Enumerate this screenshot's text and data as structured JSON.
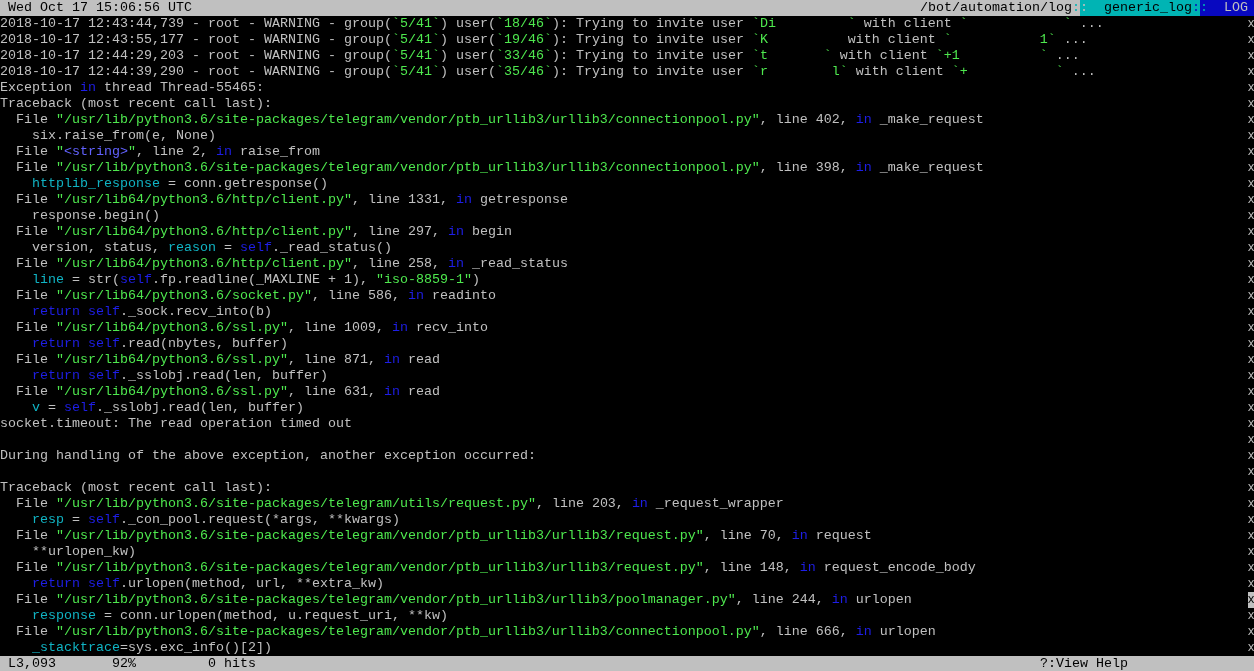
{
  "top_bar": {
    "clock": "Wed Oct 17 15:06:56 UTC",
    "crumbs": [
      {
        "kind": "path",
        "text": "/bot/automation/log",
        "after": ":"
      },
      {
        "kind": "format",
        "before": ":",
        "text": "generic_log",
        "after": ":"
      },
      {
        "kind": "view",
        "before": ":",
        "text": "LOG"
      }
    ]
  },
  "lines": [
    {
      "kind": "entry",
      "segments": [
        {
          "text": "2018-10-17 12:43:44,739 - root - WARNING - group(",
          "kind": "plain"
        },
        {
          "text": "`5/41`",
          "kind": "string"
        },
        {
          "text": ") user(",
          "kind": "plain"
        },
        {
          "text": "`18/46`",
          "kind": "string"
        },
        {
          "text": "): Trying to invite user ",
          "kind": "plain"
        },
        {
          "text": "`Di         `",
          "kind": "string"
        },
        {
          "text": " with client ",
          "kind": "plain"
        },
        {
          "text": "`            `",
          "kind": "string"
        },
        {
          "text": " ...",
          "kind": "plain"
        }
      ]
    },
    {
      "kind": "entry",
      "segments": [
        {
          "text": "2018-10-17 12:43:55,177 - root - WARNING - group(",
          "kind": "plain"
        },
        {
          "text": "`5/41`",
          "kind": "string"
        },
        {
          "text": ") user(",
          "kind": "plain"
        },
        {
          "text": "`19/46`",
          "kind": "string"
        },
        {
          "text": "): Trying to invite user ",
          "kind": "plain"
        },
        {
          "text": "`K         ",
          "kind": "string"
        },
        {
          "text": " with client ",
          "kind": "plain"
        },
        {
          "text": "`           1`",
          "kind": "string"
        },
        {
          "text": " ...",
          "kind": "plain"
        }
      ]
    },
    {
      "kind": "entry",
      "segments": [
        {
          "text": "2018-10-17 12:44:29,203 - root - WARNING - group(",
          "kind": "plain"
        },
        {
          "text": "`5/41`",
          "kind": "string"
        },
        {
          "text": ") user(",
          "kind": "plain"
        },
        {
          "text": "`33/46`",
          "kind": "string"
        },
        {
          "text": "): Trying to invite user ",
          "kind": "plain"
        },
        {
          "text": "`t       `",
          "kind": "string"
        },
        {
          "text": " with client ",
          "kind": "plain"
        },
        {
          "text": "`+1          `",
          "kind": "string"
        },
        {
          "text": " ...",
          "kind": "plain"
        }
      ]
    },
    {
      "kind": "entry",
      "segments": [
        {
          "text": "2018-10-17 12:44:39,290 - root - WARNING - group(",
          "kind": "plain"
        },
        {
          "text": "`5/41`",
          "kind": "string"
        },
        {
          "text": ") user(",
          "kind": "plain"
        },
        {
          "text": "`35/46`",
          "kind": "string"
        },
        {
          "text": "): Trying to invite user ",
          "kind": "plain"
        },
        {
          "text": "`r        l`",
          "kind": "string"
        },
        {
          "text": " with client ",
          "kind": "plain"
        },
        {
          "text": "`+           `",
          "kind": "string"
        },
        {
          "text": " ...",
          "kind": "plain"
        }
      ]
    },
    {
      "kind": "message",
      "segments": [
        {
          "text": "Exception ",
          "kind": "plain"
        },
        {
          "text": "in",
          "kind": "keyword"
        },
        {
          "text": " thread Thread-55465:",
          "kind": "plain"
        }
      ]
    },
    {
      "kind": "message",
      "segments": [
        {
          "text": "Traceback (most recent call last):",
          "kind": "plain"
        }
      ]
    },
    {
      "kind": "frame",
      "segments": [
        {
          "text": "File ",
          "kind": "plain"
        },
        {
          "text": "\"/usr/lib/python3.6/site-packages/telegram/vendor/ptb_urllib3/urllib3/connectionpool.py\"",
          "kind": "string"
        },
        {
          "text": ", line 402, ",
          "kind": "plain"
        },
        {
          "text": "in",
          "kind": "keyword"
        },
        {
          "text": " _make_request",
          "kind": "plain"
        }
      ]
    },
    {
      "kind": "source",
      "segments": [
        {
          "text": "six.raise_from(e, None)",
          "kind": "plain"
        }
      ]
    },
    {
      "kind": "frame",
      "segments": [
        {
          "text": "File ",
          "kind": "plain"
        },
        {
          "text": "\"",
          "kind": "string"
        },
        {
          "text": "<string>",
          "kind": "literal"
        },
        {
          "text": "\"",
          "kind": "string"
        },
        {
          "text": ", line 2, ",
          "kind": "plain"
        },
        {
          "text": "in",
          "kind": "keyword"
        },
        {
          "text": " raise_from",
          "kind": "plain"
        }
      ]
    },
    {
      "kind": "frame",
      "segments": [
        {
          "text": "File ",
          "kind": "plain"
        },
        {
          "text": "\"/usr/lib/python3.6/site-packages/telegram/vendor/ptb_urllib3/urllib3/connectionpool.py\"",
          "kind": "string"
        },
        {
          "text": ", line 398, ",
          "kind": "plain"
        },
        {
          "text": "in",
          "kind": "keyword"
        },
        {
          "text": " _make_request",
          "kind": "plain"
        }
      ]
    },
    {
      "kind": "source",
      "segments": [
        {
          "text": "httplib_response",
          "kind": "name"
        },
        {
          "text": " = conn.getresponse()",
          "kind": "plain"
        }
      ]
    },
    {
      "kind": "frame",
      "segments": [
        {
          "text": "File ",
          "kind": "plain"
        },
        {
          "text": "\"/usr/lib64/python3.6/http/client.py\"",
          "kind": "string"
        },
        {
          "text": ", line 1331, ",
          "kind": "plain"
        },
        {
          "text": "in",
          "kind": "keyword"
        },
        {
          "text": " getresponse",
          "kind": "plain"
        }
      ]
    },
    {
      "kind": "source",
      "segments": [
        {
          "text": "response.begin()",
          "kind": "plain"
        }
      ]
    },
    {
      "kind": "frame",
      "segments": [
        {
          "text": "File ",
          "kind": "plain"
        },
        {
          "text": "\"/usr/lib64/python3.6/http/client.py\"",
          "kind": "string"
        },
        {
          "text": ", line 297, ",
          "kind": "plain"
        },
        {
          "text": "in",
          "kind": "keyword"
        },
        {
          "text": " begin",
          "kind": "plain"
        }
      ]
    },
    {
      "kind": "source",
      "segments": [
        {
          "text": "version, status, ",
          "kind": "plain"
        },
        {
          "text": "reason",
          "kind": "name"
        },
        {
          "text": " = ",
          "kind": "plain"
        },
        {
          "text": "self",
          "kind": "keyword"
        },
        {
          "text": "._read_status()",
          "kind": "plain"
        }
      ]
    },
    {
      "kind": "frame",
      "segments": [
        {
          "text": "File ",
          "kind": "plain"
        },
        {
          "text": "\"/usr/lib64/python3.6/http/client.py\"",
          "kind": "string"
        },
        {
          "text": ", line 258, ",
          "kind": "plain"
        },
        {
          "text": "in",
          "kind": "keyword"
        },
        {
          "text": " _read_status",
          "kind": "plain"
        }
      ]
    },
    {
      "kind": "source",
      "segments": [
        {
          "text": "line",
          "kind": "name"
        },
        {
          "text": " = str(",
          "kind": "plain"
        },
        {
          "text": "self",
          "kind": "keyword"
        },
        {
          "text": ".fp.readline(_MAXLINE + 1), ",
          "kind": "plain"
        },
        {
          "text": "\"iso-8859-1\"",
          "kind": "string"
        },
        {
          "text": ")",
          "kind": "plain"
        }
      ]
    },
    {
      "kind": "frame",
      "segments": [
        {
          "text": "File ",
          "kind": "plain"
        },
        {
          "text": "\"/usr/lib64/python3.6/socket.py\"",
          "kind": "string"
        },
        {
          "text": ", line 586, ",
          "kind": "plain"
        },
        {
          "text": "in",
          "kind": "keyword"
        },
        {
          "text": " readinto",
          "kind": "plain"
        }
      ]
    },
    {
      "kind": "source",
      "segments": [
        {
          "text": "return self",
          "kind": "keyword"
        },
        {
          "text": "._sock.recv_into(b)",
          "kind": "plain"
        }
      ]
    },
    {
      "kind": "frame",
      "segments": [
        {
          "text": "File ",
          "kind": "plain"
        },
        {
          "text": "\"/usr/lib64/python3.6/ssl.py\"",
          "kind": "string"
        },
        {
          "text": ", line 1009, ",
          "kind": "plain"
        },
        {
          "text": "in",
          "kind": "keyword"
        },
        {
          "text": " recv_into",
          "kind": "plain"
        }
      ]
    },
    {
      "kind": "source",
      "segments": [
        {
          "text": "return self",
          "kind": "keyword"
        },
        {
          "text": ".read(nbytes, buffer)",
          "kind": "plain"
        }
      ]
    },
    {
      "kind": "frame",
      "segments": [
        {
          "text": "File ",
          "kind": "plain"
        },
        {
          "text": "\"/usr/lib64/python3.6/ssl.py\"",
          "kind": "string"
        },
        {
          "text": ", line 871, ",
          "kind": "plain"
        },
        {
          "text": "in",
          "kind": "keyword"
        },
        {
          "text": " read",
          "kind": "plain"
        }
      ]
    },
    {
      "kind": "source",
      "segments": [
        {
          "text": "return self",
          "kind": "keyword"
        },
        {
          "text": "._sslobj.read(len, buffer)",
          "kind": "plain"
        }
      ]
    },
    {
      "kind": "frame",
      "segments": [
        {
          "text": "File ",
          "kind": "plain"
        },
        {
          "text": "\"/usr/lib64/python3.6/ssl.py\"",
          "kind": "string"
        },
        {
          "text": ", line 631, ",
          "kind": "plain"
        },
        {
          "text": "in",
          "kind": "keyword"
        },
        {
          "text": " read",
          "kind": "plain"
        }
      ]
    },
    {
      "kind": "source",
      "segments": [
        {
          "text": "v",
          "kind": "name"
        },
        {
          "text": " = ",
          "kind": "plain"
        },
        {
          "text": "self",
          "kind": "keyword"
        },
        {
          "text": "._sslobj.read(len, buffer)",
          "kind": "plain"
        }
      ]
    },
    {
      "kind": "message",
      "segments": [
        {
          "text": "socket.timeout: The read operation timed out",
          "kind": "plain"
        }
      ]
    },
    {
      "kind": "blank"
    },
    {
      "kind": "message",
      "segments": [
        {
          "text": "During handling of the above exception, another exception occurred:",
          "kind": "plain"
        }
      ]
    },
    {
      "kind": "blank"
    },
    {
      "kind": "message",
      "segments": [
        {
          "text": "Traceback (most recent call last):",
          "kind": "plain"
        }
      ]
    },
    {
      "kind": "frame",
      "segments": [
        {
          "text": "File ",
          "kind": "plain"
        },
        {
          "text": "\"/usr/lib/python3.6/site-packages/telegram/utils/request.py\"",
          "kind": "string"
        },
        {
          "text": ", line 203, ",
          "kind": "plain"
        },
        {
          "text": "in",
          "kind": "keyword"
        },
        {
          "text": " _request_wrapper",
          "kind": "plain"
        }
      ]
    },
    {
      "kind": "source",
      "segments": [
        {
          "text": "resp",
          "kind": "name"
        },
        {
          "text": " = ",
          "kind": "plain"
        },
        {
          "text": "self",
          "kind": "keyword"
        },
        {
          "text": "._con_pool.request(*args, **kwargs)",
          "kind": "plain"
        }
      ]
    },
    {
      "kind": "frame",
      "segments": [
        {
          "text": "File ",
          "kind": "plain"
        },
        {
          "text": "\"/usr/lib/python3.6/site-packages/telegram/vendor/ptb_urllib3/urllib3/request.py\"",
          "kind": "string"
        },
        {
          "text": ", line 70, ",
          "kind": "plain"
        },
        {
          "text": "in",
          "kind": "keyword"
        },
        {
          "text": " request",
          "kind": "plain"
        }
      ]
    },
    {
      "kind": "source",
      "segments": [
        {
          "text": "**urlopen_kw)",
          "kind": "plain"
        }
      ]
    },
    {
      "kind": "frame",
      "segments": [
        {
          "text": "File ",
          "kind": "plain"
        },
        {
          "text": "\"/usr/lib/python3.6/site-packages/telegram/vendor/ptb_urllib3/urllib3/request.py\"",
          "kind": "string"
        },
        {
          "text": ", line 148, ",
          "kind": "plain"
        },
        {
          "text": "in",
          "kind": "keyword"
        },
        {
          "text": " request_encode_body",
          "kind": "plain"
        }
      ]
    },
    {
      "kind": "source",
      "segments": [
        {
          "text": "return self",
          "kind": "keyword"
        },
        {
          "text": ".urlopen(method, url, **extra_kw)",
          "kind": "plain"
        }
      ]
    },
    {
      "kind": "frame",
      "segments": [
        {
          "text": "File ",
          "kind": "plain"
        },
        {
          "text": "\"/usr/lib/python3.6/site-packages/telegram/vendor/ptb_urllib3/urllib3/poolmanager.py\"",
          "kind": "string"
        },
        {
          "text": ", line 244, ",
          "kind": "plain"
        },
        {
          "text": "in",
          "kind": "keyword"
        },
        {
          "text": " urlopen",
          "kind": "plain"
        }
      ]
    },
    {
      "kind": "source",
      "segments": [
        {
          "text": "response",
          "kind": "name"
        },
        {
          "text": " = conn.urlopen(method, u.request_uri, **kw)",
          "kind": "plain"
        }
      ]
    },
    {
      "kind": "frame",
      "segments": [
        {
          "text": "File ",
          "kind": "plain"
        },
        {
          "text": "\"/usr/lib/python3.6/site-packages/telegram/vendor/ptb_urllib3/urllib3/connectionpool.py\"",
          "kind": "string"
        },
        {
          "text": ", line 666, ",
          "kind": "plain"
        },
        {
          "text": "in",
          "kind": "keyword"
        },
        {
          "text": " urlopen",
          "kind": "plain"
        }
      ]
    },
    {
      "kind": "source",
      "segments": [
        {
          "text": "_stacktrace",
          "kind": "name"
        },
        {
          "text": "=sys.exc_info()[2])",
          "kind": "plain"
        }
      ]
    }
  ],
  "scrollbar": [
    {
      "glyph": "x",
      "thumb": false
    },
    {
      "glyph": "x",
      "thumb": false
    },
    {
      "glyph": "x",
      "thumb": false
    },
    {
      "glyph": "x",
      "thumb": false
    },
    {
      "glyph": "x",
      "thumb": false
    },
    {
      "glyph": "x",
      "thumb": false
    },
    {
      "glyph": "x",
      "thumb": false
    },
    {
      "glyph": "x",
      "thumb": false
    },
    {
      "glyph": "x",
      "thumb": false
    },
    {
      "glyph": "x",
      "thumb": false
    },
    {
      "glyph": "x",
      "thumb": false
    },
    {
      "glyph": "x",
      "thumb": false
    },
    {
      "glyph": "x",
      "thumb": false
    },
    {
      "glyph": "x",
      "thumb": false
    },
    {
      "glyph": "x",
      "thumb": false
    },
    {
      "glyph": "x",
      "thumb": false
    },
    {
      "glyph": "x",
      "thumb": false
    },
    {
      "glyph": "x",
      "thumb": false
    },
    {
      "glyph": "x",
      "thumb": false
    },
    {
      "glyph": "x",
      "thumb": false
    },
    {
      "glyph": "x",
      "thumb": false
    },
    {
      "glyph": "x",
      "thumb": false
    },
    {
      "glyph": "x",
      "thumb": false
    },
    {
      "glyph": "x",
      "thumb": false
    },
    {
      "glyph": "x",
      "thumb": false
    },
    {
      "glyph": "x",
      "thumb": false
    },
    {
      "glyph": "x",
      "thumb": false
    },
    {
      "glyph": "x",
      "thumb": false
    },
    {
      "glyph": "x",
      "thumb": false
    },
    {
      "glyph": "x",
      "thumb": false
    },
    {
      "glyph": "x",
      "thumb": false
    },
    {
      "glyph": "x",
      "thumb": false
    },
    {
      "glyph": "x",
      "thumb": false
    },
    {
      "glyph": "x",
      "thumb": false
    },
    {
      "glyph": "x",
      "thumb": false
    },
    {
      "glyph": "x",
      "thumb": false
    },
    {
      "glyph": "x",
      "thumb": true
    },
    {
      "glyph": "x",
      "thumb": false
    },
    {
      "glyph": "x",
      "thumb": false
    },
    {
      "glyph": "x",
      "thumb": false
    }
  ],
  "bottom_bar": {
    "items": [
      {
        "kind": "line",
        "text": "L3,093"
      },
      {
        "kind": "percent",
        "text": "92%"
      },
      {
        "kind": "hits",
        "text": "0 hits"
      }
    ],
    "help": "?:View Help"
  }
}
